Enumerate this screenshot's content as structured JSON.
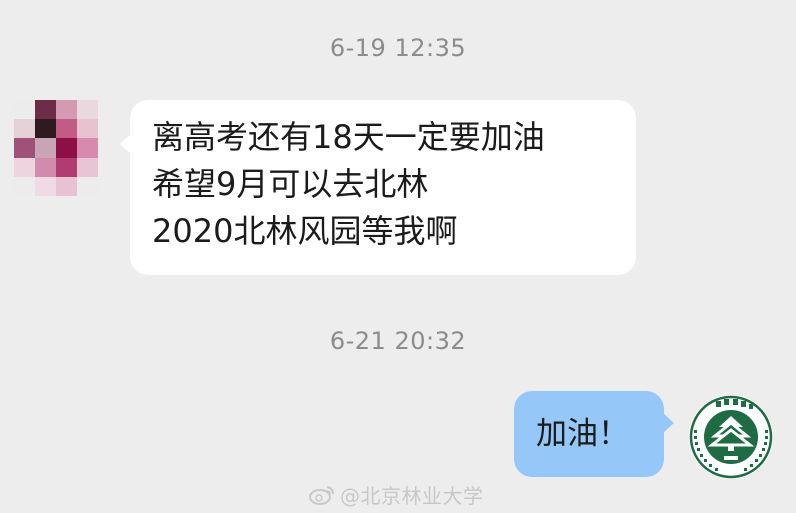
{
  "timestamps": {
    "first": "6-19 12:35",
    "second": "6-21 20:32"
  },
  "incoming_message": {
    "lines": [
      "离高考还有18天一定要加油",
      "希望9月可以去北林",
      "2020北林风园等我啊"
    ]
  },
  "outgoing_message": {
    "text": "加油！"
  },
  "avatar_right": {
    "seal_top_text": "北京林业大学",
    "seal_bottom_text": "BEIJING FORESTRY UNIVERSITY",
    "seal_year": "1952"
  },
  "watermark": {
    "text": "@北京林业大学",
    "icon": "weibo-icon"
  },
  "colors": {
    "background": "#ededed",
    "incoming_bubble": "#ffffff",
    "outgoing_bubble": "#95c8f8",
    "seal_green": "#1f6b44"
  }
}
